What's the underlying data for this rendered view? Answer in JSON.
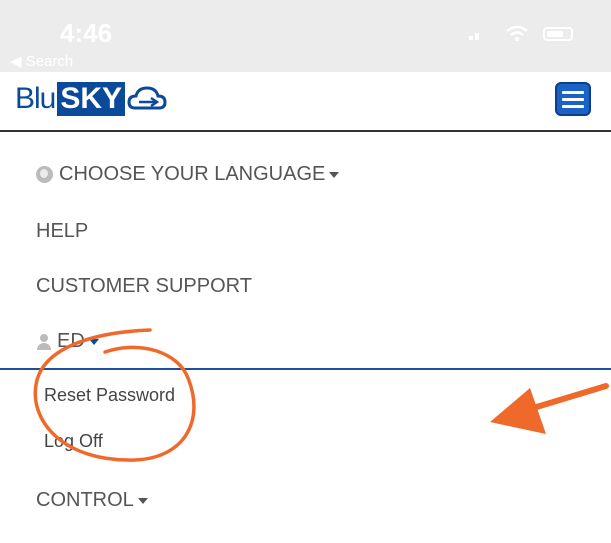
{
  "status": {
    "time": "4:46",
    "back": "◀ Search"
  },
  "brand": {
    "blu": "Blu",
    "sky": "SKY"
  },
  "menu": {
    "language": "CHOOSE YOUR LANGUAGE",
    "help": "HELP",
    "support": "CUSTOMER SUPPORT",
    "user": "ED",
    "reset_password": "Reset Password",
    "log_off": "Log Off",
    "control": "CONTROL"
  },
  "colors": {
    "brand": "#0b4a9a",
    "annotation": "#ef6a2a"
  }
}
